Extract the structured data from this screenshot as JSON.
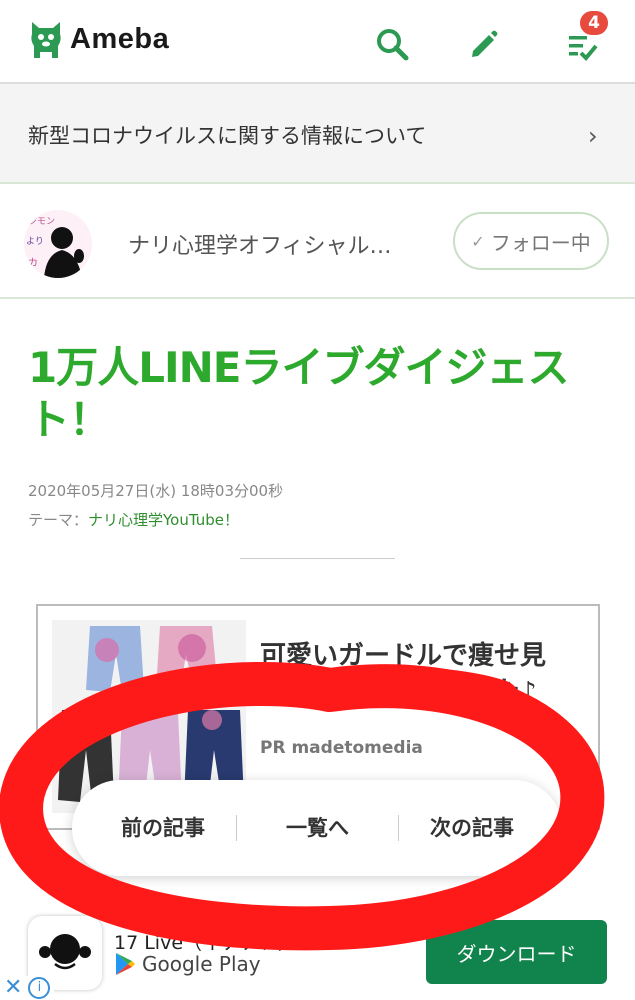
{
  "header": {
    "logo_text": "Ameba",
    "notification_count": "4",
    "icons": [
      "ameba-logo-icon",
      "search-icon",
      "pencil-icon",
      "notification-list-icon"
    ],
    "accent_color": "#2c9a52",
    "badge_color": "#e84a3d"
  },
  "notice": {
    "text": "新型コロナウイルスに関する情報について"
  },
  "blog": {
    "name": "ナリ心理学オフィシャル…",
    "follow_label": "フォロー中"
  },
  "article": {
    "title": "1万人LINEライブダイジェスト！",
    "date": "2020年05月27日(水) 18時03分00秒",
    "theme_label": "テーマ：",
    "theme_value": "ナリ心理学YouTube！",
    "title_color": "#2daa2d"
  },
  "ad": {
    "title": "可愛いガードルで痩せ見え！スキニーも履けた♪",
    "sponsor": "PR madetomedia"
  },
  "article_nav": {
    "prev": "前の記事",
    "list": "一覧へ",
    "next": "次の記事"
  },
  "app_banner": {
    "app_name": "17 Live（イチナナ）",
    "store": "Google Play",
    "download": "ダウンロード",
    "button_color": "#11834c"
  },
  "annotation": {
    "color": "#ff1a1a"
  }
}
